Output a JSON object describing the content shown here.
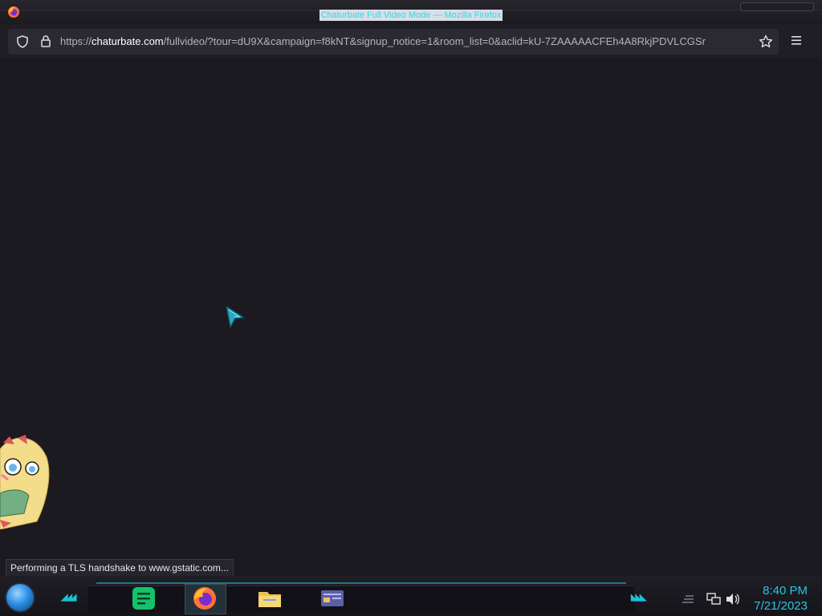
{
  "window": {
    "title": "Chaturbate Full Video Mode — Mozilla Firefox"
  },
  "navbar": {
    "url_scheme": "https://",
    "url_host": "chaturbate.com",
    "url_path": "/fullvideo/?tour=dU9X&campaign=f8kNT&signup_notice=1&room_list=0&aclid=kU-7ZAAAAACFEh4A8RkjPDVLCGSr"
  },
  "status_bar": {
    "text": "Performing a TLS handshake to www.gstatic.com..."
  },
  "taskbar": {
    "apps": [
      "chat-app",
      "firefox",
      "file-explorer",
      "window-switcher"
    ],
    "time": "8:40 PM",
    "date": "7/21/2023"
  },
  "colors": {
    "accent": "#1fb1c9",
    "clock": "#28c4e2",
    "content_bg": "#1b1a20"
  }
}
